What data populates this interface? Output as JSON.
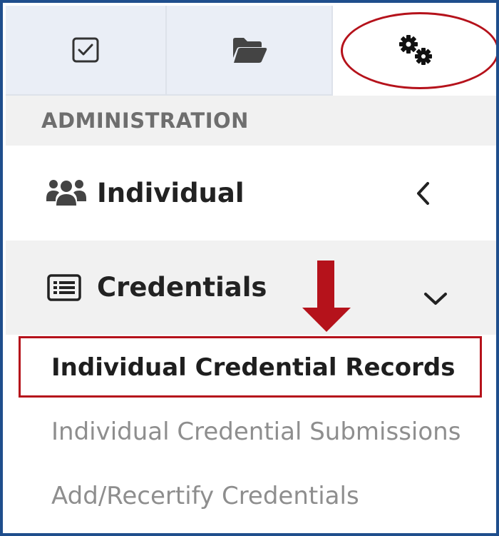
{
  "tabs": [
    {
      "icon": "checkbox-icon"
    },
    {
      "icon": "folder-open-icon"
    },
    {
      "icon": "cogs-icon",
      "active": true
    }
  ],
  "section": {
    "title": "ADMINISTRATION"
  },
  "menu": {
    "individual": {
      "label": "Individual",
      "icon": "users-icon",
      "chevron": "chevron-left-icon"
    },
    "credentials": {
      "label": "Credentials",
      "icon": "list-alt-icon",
      "chevron": "chevron-down-icon"
    }
  },
  "submenu": {
    "items": [
      {
        "label": "Individual Credential Records",
        "active": true
      },
      {
        "label": "Individual Credential Submissions"
      },
      {
        "label": "Add/Recertify Credentials"
      }
    ]
  },
  "colors": {
    "frame_border": "#1f4e8c",
    "annotation_red": "#b5121b",
    "tab_bg": "#eaeef6",
    "section_bg": "#f1f1f1"
  }
}
